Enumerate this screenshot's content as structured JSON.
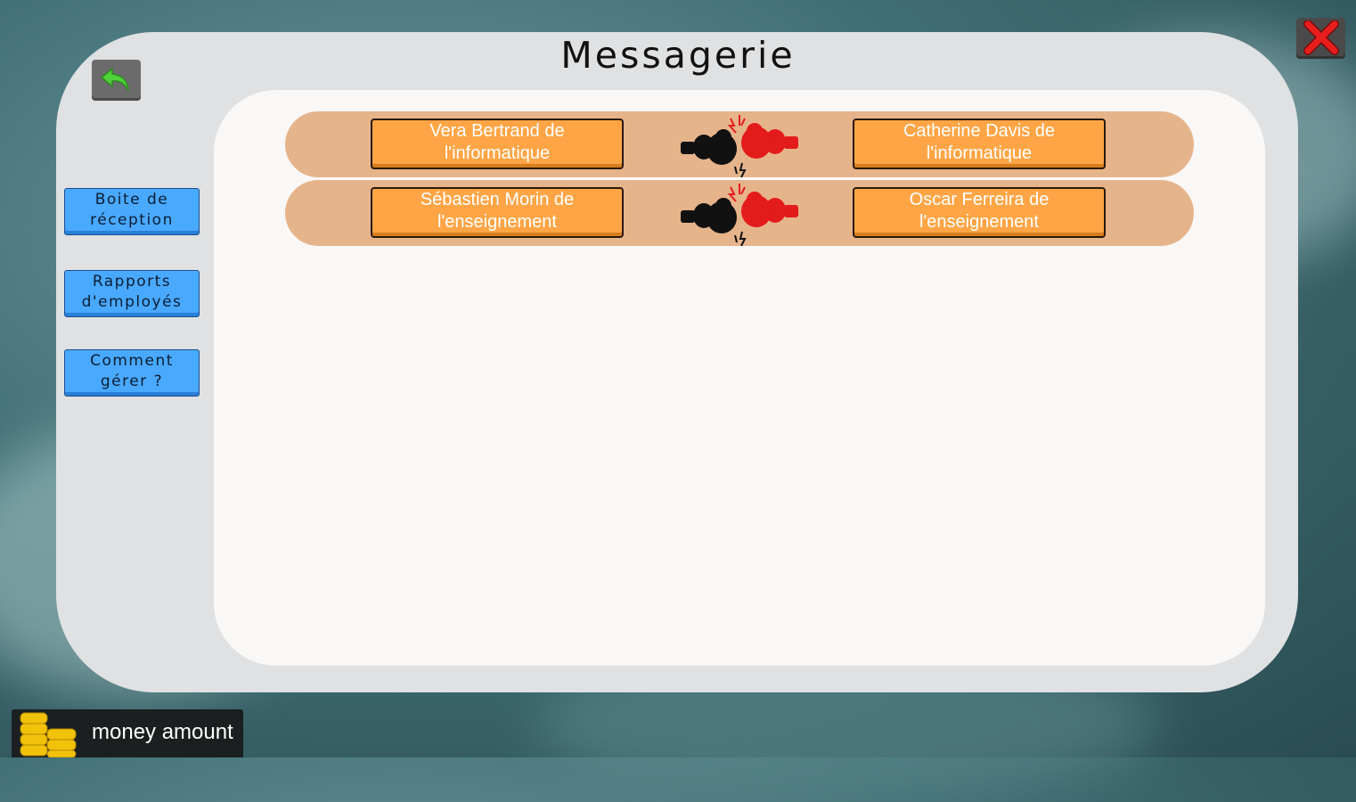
{
  "window": {
    "title": "Messagerie"
  },
  "nav": {
    "back_icon": "back-arrow-icon",
    "close_icon": "close-x-icon"
  },
  "sidebar": {
    "items": [
      {
        "label": "Boite de\nréception"
      },
      {
        "label": "Rapports\nd'employés"
      },
      {
        "label": "Comment\ngérer ?"
      }
    ]
  },
  "conflicts": [
    {
      "left": "Vera Bertrand de\nl'informatique",
      "right": "Catherine Davis de\nl'informatique",
      "icon": "boxing-gloves-icon"
    },
    {
      "left": "Sébastien Morin de\nl'enseignement",
      "right": "Oscar Ferreira de\nl'enseignement",
      "icon": "boxing-gloves-icon"
    }
  ],
  "footer": {
    "money_label": "money amount",
    "icon": "coins-icon"
  },
  "colors": {
    "side_button": "#49a9ff",
    "person_button": "#ffa545",
    "row_band": "#e6b48b",
    "back_arrow": "#4fd13a",
    "close_x": "#e81e1e"
  }
}
